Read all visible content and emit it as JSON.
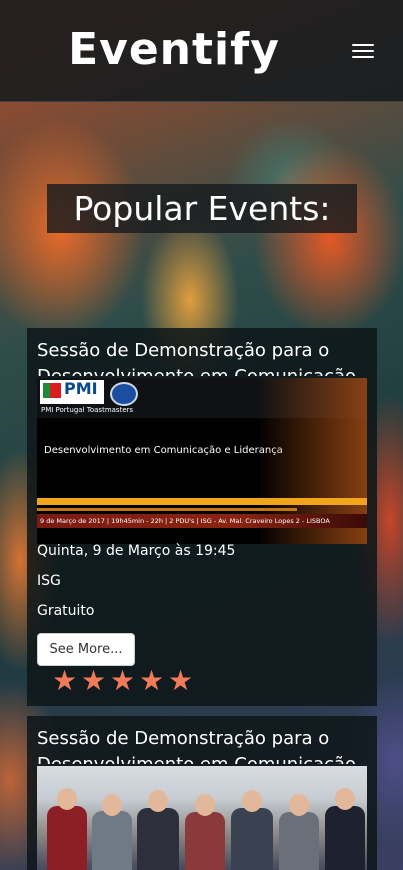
{
  "app": {
    "brand": "Eventify"
  },
  "header": {
    "menu_icon": "hamburger-icon"
  },
  "main": {
    "title": "Popular Events:"
  },
  "events": [
    {
      "title": "Sessão de Demonstração para o Desenvolvimento em Comunicação",
      "image": {
        "logo_text": "PMI",
        "subtitle": "PMI Portugal Toastmasters",
        "caption": "Desenvolvimento em Comunicação e Liderança",
        "strip": "9 de Março de  2017  |  19h45min - 22h  |  2 PDU's  |  ISG - Av. Mal. Craveiro Lopes 2 - LISBOA"
      },
      "date": "Quinta, 9 de Março às 19:45",
      "location": "ISG",
      "price": "Gratuito",
      "cta": "See More...",
      "rating": 5
    },
    {
      "title": "Sessão de Demonstração para o Desenvolvimento em Comunicação"
    }
  ],
  "colors": {
    "accent_star": "#f07b5a",
    "header_bg": "#141a1e"
  }
}
